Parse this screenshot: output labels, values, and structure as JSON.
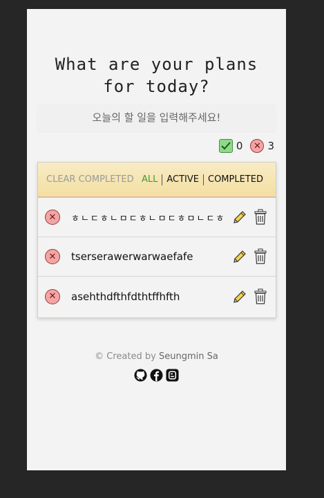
{
  "header": {
    "title_line1": "What are your plans",
    "title_line2": "for today?"
  },
  "input": {
    "placeholder": "오늘의 할 일을 입력해주세요!"
  },
  "stats": {
    "completed_count": "0",
    "remaining_count": "3"
  },
  "toolbar": {
    "clear_label": "CLEAR COMPLETED",
    "filters": [
      {
        "label": "ALL",
        "active": true
      },
      {
        "label": "ACTIVE",
        "active": false
      },
      {
        "label": "COMPLETED",
        "active": false
      }
    ]
  },
  "todos": [
    {
      "text": "ㅎㄴㄷㅎㄴㅁㄷㅎㄴㅁㄷㅎㅁㄴㄷㅎ"
    },
    {
      "text": "tserserawerwarwaefafe"
    },
    {
      "text": "asehthdfthfdthtffhfth"
    }
  ],
  "footer": {
    "prefix": "© Created by",
    "author": "Seungmin Sa"
  },
  "social": [
    "github-icon",
    "facebook-icon",
    "blogger-icon"
  ],
  "colors": {
    "active_filter": "#3d9b2f",
    "header_gradient_top": "#f8ecc6",
    "header_gradient_bottom": "#f4dfa1"
  }
}
